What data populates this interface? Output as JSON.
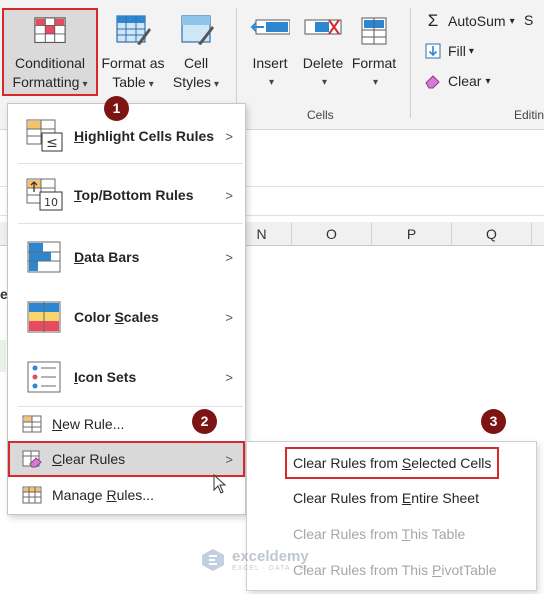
{
  "ribbon": {
    "conditional_formatting": {
      "line1": "Conditional",
      "line2": "Formatting"
    },
    "format_as_table": {
      "line1": "Format as",
      "line2": "Table"
    },
    "cell_styles": {
      "line1": "Cell",
      "line2": "Styles"
    },
    "insert": "Insert",
    "delete": "Delete",
    "format": "Format",
    "cells_group": "Cells",
    "autosum": "AutoSum",
    "fill": "Fill",
    "clear": "Clear",
    "editing_group": "Editin",
    "sort_partial": "S"
  },
  "columns": [
    "N",
    "O",
    "P",
    "Q"
  ],
  "row_fragment": "e",
  "menu": {
    "highlight": {
      "pre": "",
      "key": "H",
      "post": "ighlight Cells Rules"
    },
    "topbottom": {
      "pre": "",
      "key": "T",
      "post": "op/Bottom Rules"
    },
    "databars": {
      "pre": "",
      "key": "D",
      "post": "ata Bars"
    },
    "colorscales": {
      "pre": "Color ",
      "key": "S",
      "post": "cales"
    },
    "iconsets": {
      "pre": "",
      "key": "I",
      "post": "con Sets"
    },
    "newrule": {
      "pre": "",
      "key": "N",
      "post": "ew Rule..."
    },
    "clearrules": {
      "pre": "",
      "key": "C",
      "post": "lear Rules"
    },
    "managerules": {
      "pre": "Manage ",
      "key": "R",
      "post": "ules..."
    }
  },
  "submenu": {
    "selected": {
      "pre": "Clear Rules from ",
      "key": "S",
      "post": "elected Cells"
    },
    "entire": {
      "pre": "Clear Rules from ",
      "key": "E",
      "post": "ntire Sheet"
    },
    "table": {
      "pre": "Clear Rules from ",
      "key": "T",
      "post": "his Table"
    },
    "pivot": {
      "pre": "Clear Rules from This ",
      "key": "P",
      "post": "ivotTable"
    }
  },
  "badges": [
    "1",
    "2",
    "3"
  ],
  "watermark": {
    "name": "exceldemy",
    "sub": "EXCEL · DATA · BI"
  },
  "icons": {
    "caret": "chevron-down-icon",
    "arrow": "chevron-right-icon"
  },
  "colors": {
    "highlight_border": "#d62a2a",
    "badge": "#7d1414"
  }
}
